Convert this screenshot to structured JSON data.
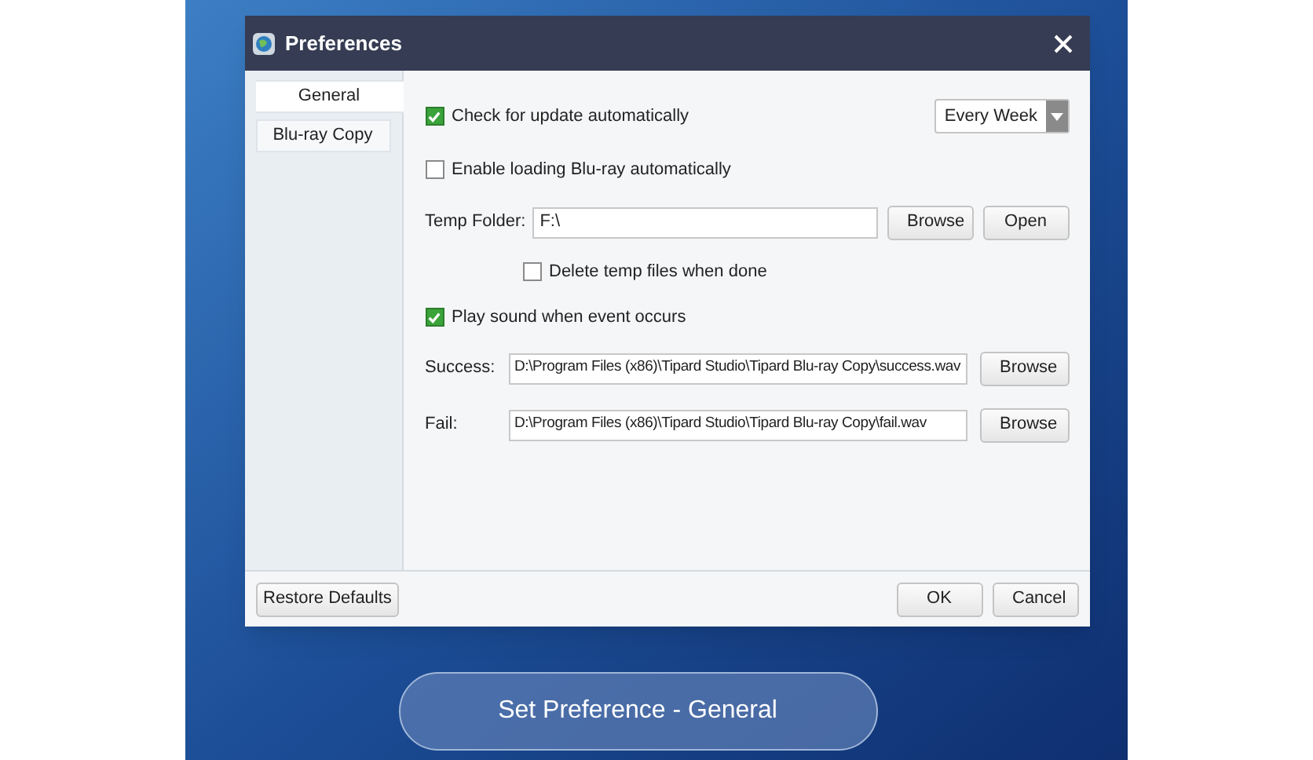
{
  "window": {
    "title": "Preferences"
  },
  "sidebar": {
    "items": [
      {
        "label": "General",
        "selected": true
      },
      {
        "label": "Blu-ray Copy",
        "selected": false
      }
    ]
  },
  "general": {
    "check_update": {
      "label": "Check for update automatically",
      "checked": true
    },
    "update_frequency": {
      "value": "Every Week"
    },
    "enable_loading": {
      "label": "Enable loading Blu-ray automatically",
      "checked": false
    },
    "temp_folder": {
      "label": "Temp Folder:",
      "value": "F:\\",
      "buttons": [
        "Browse",
        "Open"
      ]
    },
    "delete_temp": {
      "label": "Delete temp files when done",
      "checked": false
    },
    "play_sound": {
      "label": "Play sound when event occurs",
      "checked": true
    },
    "sounds": [
      {
        "label": "Success:",
        "value": "D:\\Program Files (x86)\\Tipard Studio\\Tipard Blu-ray Copy\\success.wav",
        "button": "Browse"
      },
      {
        "label": "Fail:",
        "value": "D:\\Program Files (x86)\\Tipard Studio\\Tipard Blu-ray Copy\\fail.wav",
        "button": "Browse"
      }
    ]
  },
  "footer": {
    "restore": "Restore Defaults",
    "ok": "OK",
    "cancel": "Cancel"
  },
  "caption": "Set Preference - General"
}
